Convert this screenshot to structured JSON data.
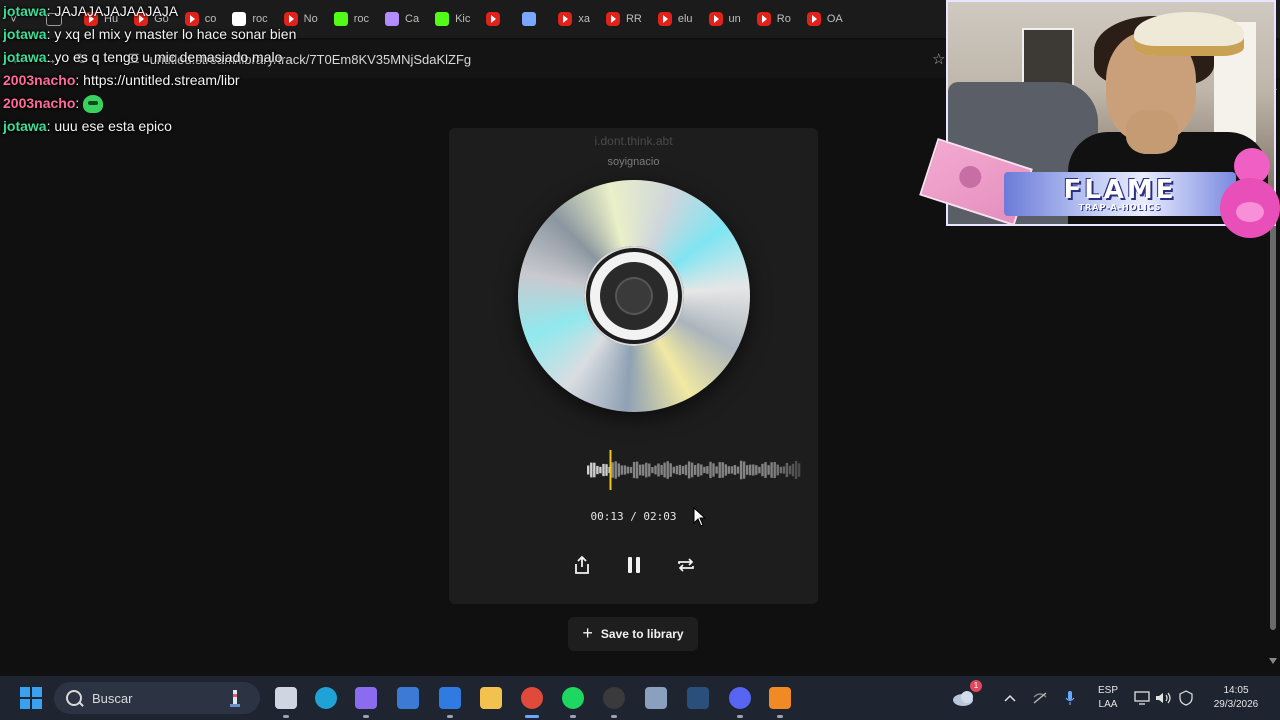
{
  "browser": {
    "tabs": [
      {
        "label": "",
        "icon": "chevron-down-icon"
      },
      {
        "label": "",
        "icon": "tab-search-icon"
      },
      {
        "label": "Hu",
        "icon": "youtube-icon"
      },
      {
        "label": "Go",
        "icon": "youtube-icon"
      },
      {
        "label": "co",
        "icon": "youtube-icon"
      },
      {
        "label": "roc",
        "icon": "google-icon"
      },
      {
        "label": "No",
        "icon": "youtube-icon"
      },
      {
        "label": "roc",
        "icon": "kick-icon"
      },
      {
        "label": "Ca",
        "icon": "feather-icon"
      },
      {
        "label": "Kic",
        "icon": "kick-icon"
      },
      {
        "label": "",
        "icon": "youtube-icon"
      },
      {
        "label": "",
        "icon": "window-icon"
      },
      {
        "label": "xa",
        "icon": "youtube-icon"
      },
      {
        "label": "RR",
        "icon": "youtube-icon"
      },
      {
        "label": "elu",
        "icon": "youtube-icon"
      },
      {
        "label": "un",
        "icon": "youtube-icon"
      },
      {
        "label": "Ro",
        "icon": "youtube-icon"
      },
      {
        "label": "OA",
        "icon": "youtube-icon"
      }
    ],
    "url": "untitled.stream/library/track/7T0Em8KV35MNjSdaKlZFg"
  },
  "chat": [
    {
      "user": "jotawa",
      "color": "#3ddc97",
      "text": "JAJAJAJAJAAJAJA"
    },
    {
      "user": "jotawa",
      "color": "#3ddc97",
      "text": "y xq el mix y master lo hace sonar bien"
    },
    {
      "user": "jotawa",
      "color": "#3ddc97",
      "text": "yo es q tengo u mic demasiado malo"
    },
    {
      "user": "2003nacho",
      "color": "#ff6b9a",
      "text": "https://untitled.stream/libr"
    },
    {
      "user": "2003nacho",
      "color": "#ff6b9a",
      "text": "",
      "emote": "green-frog-emote"
    },
    {
      "user": "jotawa",
      "color": "#3ddc97",
      "text": "uuu ese esta epico"
    }
  ],
  "player": {
    "title": "i.dont.think.abt",
    "artist": "soyignacio",
    "time_current": "00:13",
    "time_total": "02:03",
    "time_text": "00:13 / 02:03",
    "progress": 0.105,
    "accent": "#f0c419",
    "save_label": "Save to library"
  },
  "stream_overlay": {
    "banner_big": "FLAME",
    "banner_small": "TRAP-A-HOLICS"
  },
  "taskbar": {
    "search_placeholder": "Buscar",
    "apps": [
      "file-manager-icon",
      "edge-icon",
      "copilot-icon",
      "store-icon",
      "outlook-icon",
      "folder-icon",
      "chrome-icon",
      "spotify-icon",
      "obs-icon",
      "settings-icon",
      "steam-icon",
      "discord-icon",
      "fl-studio-icon"
    ],
    "language_line1": "ESP",
    "language_line2": "LAA",
    "time": "14:05",
    "date": "29/3/2026",
    "weather_badge": "1"
  }
}
